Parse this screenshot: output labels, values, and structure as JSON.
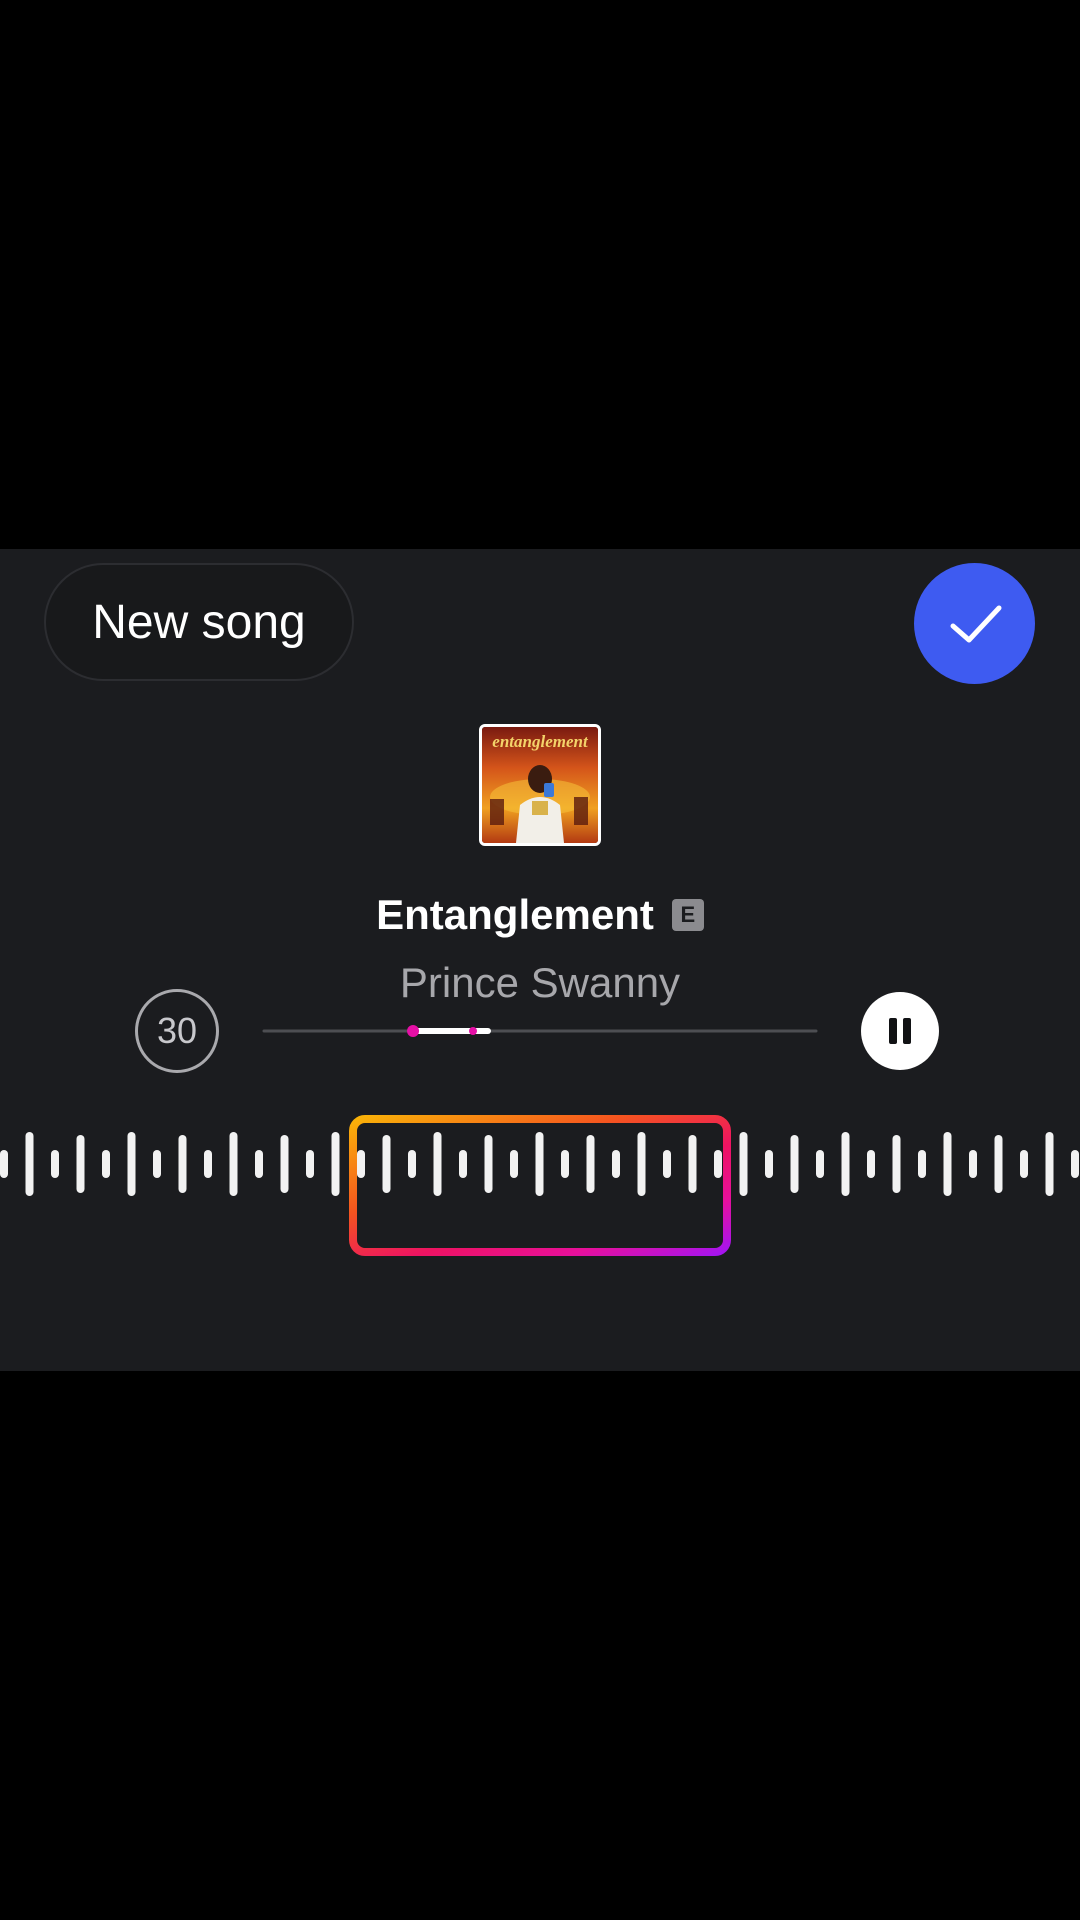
{
  "controls": {
    "new_song_label": "New song",
    "confirm_icon": "checkmark-icon",
    "duration_label": "30",
    "pause_icon": "pause-icon"
  },
  "track": {
    "title": "Entanglement",
    "explicit_label": "E",
    "artist": "Prince Swanny",
    "album_art_text": "entanglement"
  },
  "playback": {
    "progress_fraction": 0.27
  },
  "colors": {
    "panel_background": "#1b1c1f",
    "confirm_blue": "#3e5bf1",
    "accent_magenta": "#e60fa6",
    "gradient": [
      "#f9b208",
      "#f5541f",
      "#ee1362",
      "#e8109a",
      "#a514f0"
    ]
  }
}
